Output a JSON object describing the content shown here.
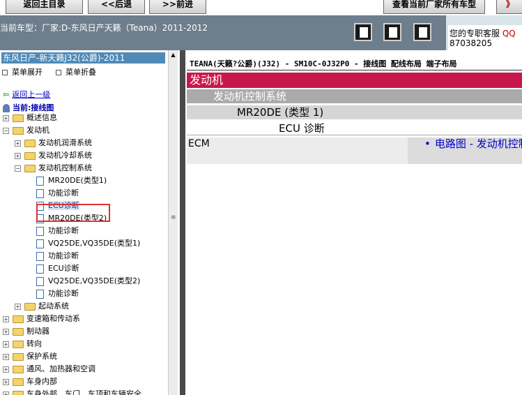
{
  "nav": {
    "home": "返回主目录",
    "back": "<<后退",
    "forward": ">>前进",
    "all_makes": "查看当前厂家所有车型",
    "more": "》"
  },
  "header": {
    "current_model": "当前车型：厂家:D-东风日产天籁（Teana）2011-2012",
    "support_label": "您的专职客服",
    "support_qq": "QQ",
    "support_number": "87038205"
  },
  "mode_icons": [
    "panel-left-icon",
    "panel-both-icon",
    "panel-right-icon"
  ],
  "sidebar": {
    "title": "东风日产-新天籁J32(公爵)-2011",
    "expand": "菜单展开",
    "collapse": "菜单折叠",
    "up": "返回上一级",
    "current": "当前:接线图",
    "tree": [
      {
        "label": "概述信息",
        "type": "folder",
        "level": 0,
        "expanded": false
      },
      {
        "label": "发动机",
        "type": "folder",
        "level": 0,
        "expanded": true
      },
      {
        "label": "发动机润滑系统",
        "type": "folder",
        "level": 1,
        "expanded": false
      },
      {
        "label": "发动机冷却系统",
        "type": "folder",
        "level": 1,
        "expanded": false
      },
      {
        "label": "发动机控制系统",
        "type": "folder",
        "level": 1,
        "expanded": true
      },
      {
        "label": "MR20DE(类型1)",
        "type": "doc",
        "level": 2
      },
      {
        "label": "功能诊断",
        "type": "doc",
        "level": 2
      },
      {
        "label": "ECU诊断",
        "type": "doc",
        "level": 2,
        "selected": true
      },
      {
        "label": "MR20DE(类型2)",
        "type": "doc",
        "level": 2
      },
      {
        "label": "功能诊断",
        "type": "doc",
        "level": 2
      },
      {
        "label": "VQ25DE,VQ35DE(类型1)",
        "type": "doc",
        "level": 2
      },
      {
        "label": "功能诊断",
        "type": "doc",
        "level": 2
      },
      {
        "label": "ECU诊断",
        "type": "doc",
        "level": 2
      },
      {
        "label": "VQ25DE,VQ35DE(类型2)",
        "type": "doc",
        "level": 2
      },
      {
        "label": "功能诊断",
        "type": "doc",
        "level": 2
      },
      {
        "label": "起动系统",
        "type": "folder",
        "level": 1,
        "expanded": false
      },
      {
        "label": "变速箱和传动系",
        "type": "folder",
        "level": 0,
        "expanded": false
      },
      {
        "label": "制动器",
        "type": "folder",
        "level": 0,
        "expanded": false
      },
      {
        "label": "转向",
        "type": "folder",
        "level": 0,
        "expanded": false
      },
      {
        "label": "保护系统",
        "type": "folder",
        "level": 0,
        "expanded": false
      },
      {
        "label": "通风、加热器和空调",
        "type": "folder",
        "level": 0,
        "expanded": false
      },
      {
        "label": "车身内部",
        "type": "folder",
        "level": 0,
        "expanded": false
      },
      {
        "label": "车身外部、车门、车顶和车辆安全",
        "type": "folder",
        "level": 0,
        "expanded": false
      }
    ]
  },
  "content": {
    "breadcrumb": "TEANA(天籁?公爵)(J32) - SM10C-0J32P0 - 接线图 配线布局 端子布局",
    "h_engine": "发动机",
    "h_ecs": "发动机控制系统",
    "h_model": "MR20DE (类型 1)",
    "h_diag": "ECU 诊断",
    "ecm": "ECM",
    "link": "电路图 - 发动机控制系统"
  },
  "colors": {
    "header_bg": "#6e7e8d",
    "accent_red": "#c8174c",
    "sidebar_title": "#4f8ab8",
    "highlight": "#e03030",
    "link": "#0000cc"
  }
}
